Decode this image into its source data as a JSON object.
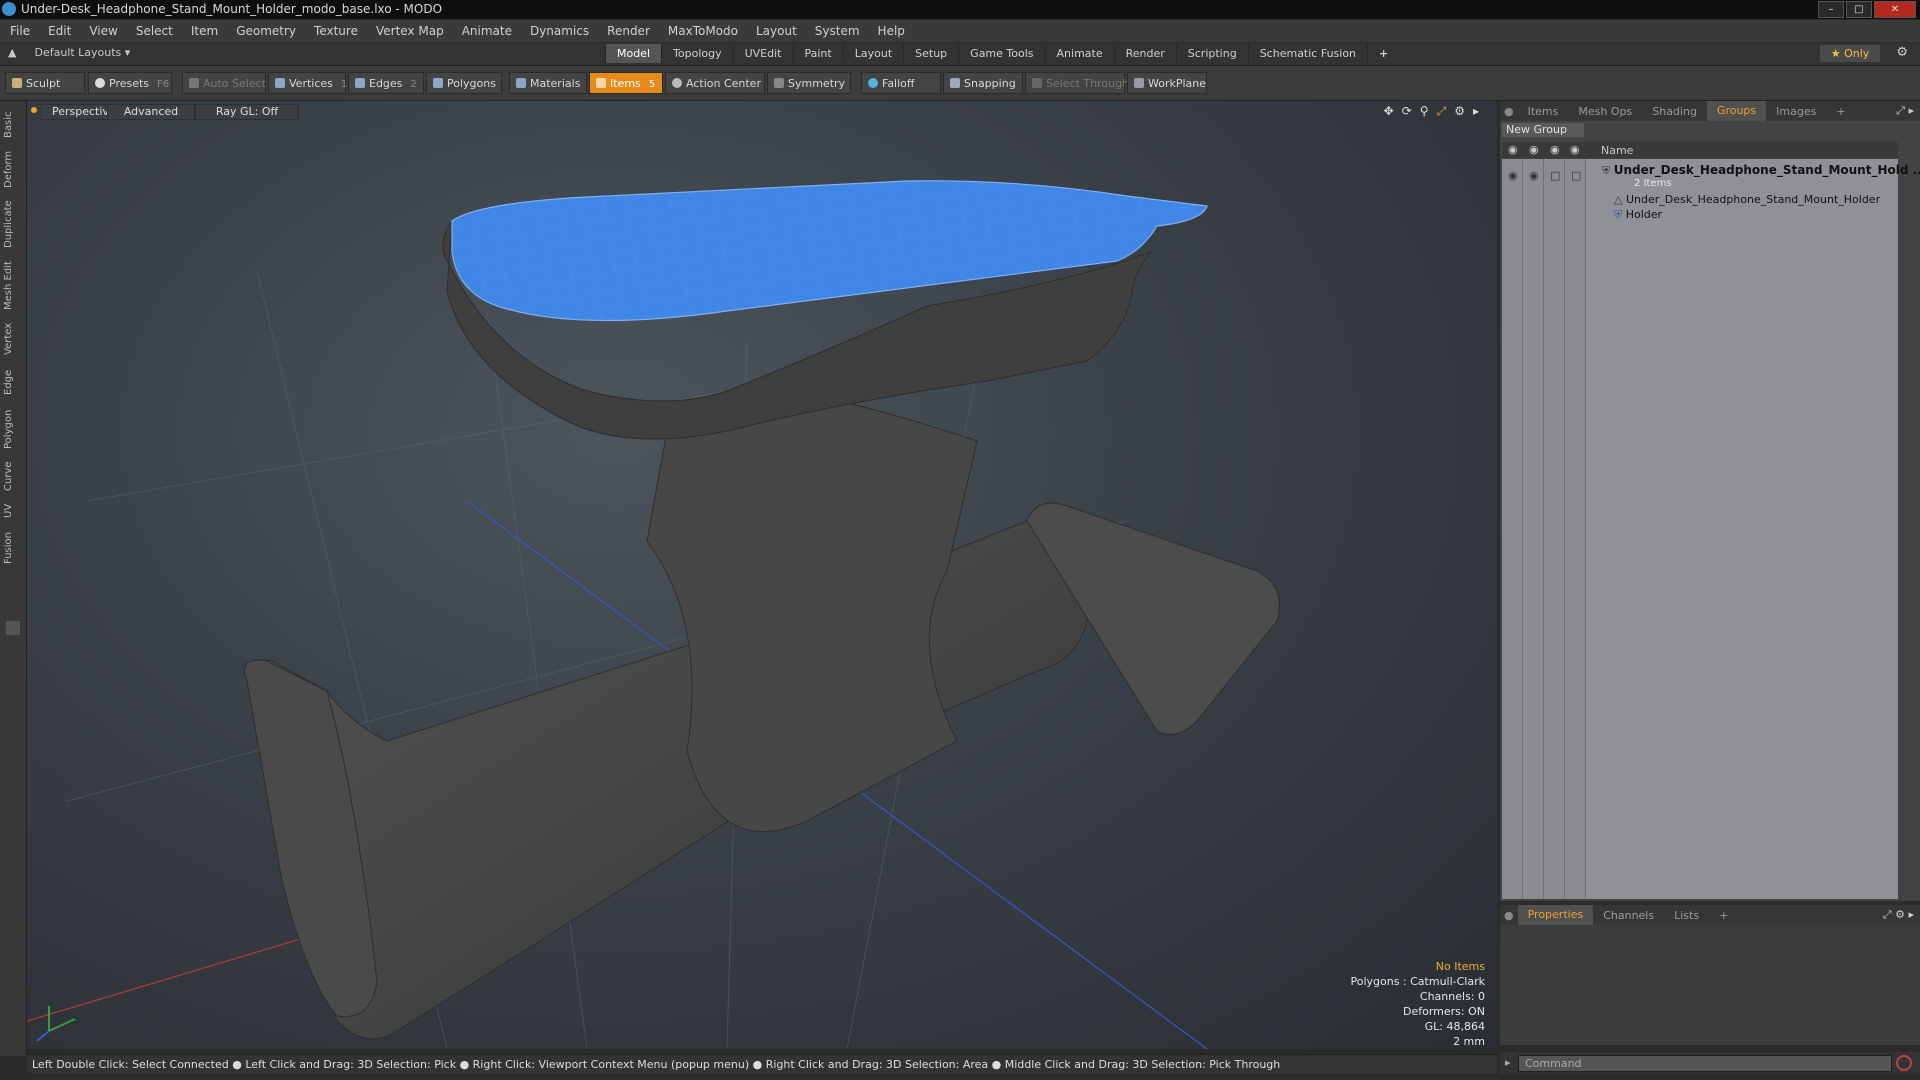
{
  "window": {
    "title": "Under-Desk_Headphone_Stand_Mount_Holder_modo_base.lxo - MODO"
  },
  "menu": [
    "File",
    "Edit",
    "View",
    "Select",
    "Item",
    "Geometry",
    "Texture",
    "Vertex Map",
    "Animate",
    "Dynamics",
    "Render",
    "MaxToModo",
    "Layout",
    "System",
    "Help"
  ],
  "layout_tabs": {
    "layouts": "Default Layouts",
    "tabs": [
      "Model",
      "Topology",
      "UVEdit",
      "Paint",
      "Layout",
      "Setup",
      "Game Tools",
      "Animate",
      "Render",
      "Scripting",
      "Schematic Fusion"
    ],
    "active": "Model",
    "add": "+",
    "only": "★ Only"
  },
  "toolbar": {
    "sculpt": "Sculpt",
    "presets": "Presets",
    "presets_key": "F6",
    "auto_select": "Auto Select",
    "vertices": "Vertices",
    "vertices_count": "1",
    "edges": "Edges",
    "edges_count": "2",
    "polygons": "Polygons",
    "materials": "Materials",
    "items": "Items",
    "items_count": "5",
    "action_center": "Action Center",
    "symmetry": "Symmetry",
    "falloff": "Falloff",
    "snapping": "Snapping",
    "select_through": "Select Through",
    "workplane": "WorkPlane"
  },
  "left_tabs": [
    "Basic",
    "Deform",
    "Duplicate",
    "Mesh Edit",
    "Vertex",
    "Edge",
    "Polygon",
    "Curve",
    "UV",
    "Fusion"
  ],
  "viewport": {
    "perspective": "Perspective",
    "advanced": "Advanced",
    "raygl": "Ray GL: Off",
    "stats": {
      "no_items": "No Items",
      "polygons": "Polygons : Catmull-Clark",
      "channels": "Channels: 0",
      "deformers": "Deformers: ON",
      "gl": "GL: 48,864",
      "unit": "2 mm"
    }
  },
  "status": "Left Double Click: Select Connected ● Left Click and Drag: 3D Selection: Pick ● Right Click: Viewport Context Menu (popup menu) ● Right Click and Drag: 3D Selection: Area ● Middle Click and Drag: 3D Selection: Pick Through",
  "right_panel": {
    "tabs": [
      "Items",
      "Mesh Ops",
      "Shading",
      "Groups",
      "Images",
      "+"
    ],
    "active": "Groups",
    "new_group": "New Group",
    "name_header": "Name",
    "group_name": "Under_Desk_Headphone_Stand_Mount_Hold ...",
    "group_count": "2 Items",
    "children": [
      "Under_Desk_Headphone_Stand_Mount_Holder",
      "Holder"
    ]
  },
  "bottom_panel": {
    "tabs": [
      "Properties",
      "Channels",
      "Lists",
      "+"
    ],
    "active": "Properties"
  },
  "command": {
    "placeholder": "Command"
  },
  "colors": {
    "accent": "#e78a1c",
    "selection_blue": "#3f86e6",
    "mesh": "#4a4a4a"
  }
}
